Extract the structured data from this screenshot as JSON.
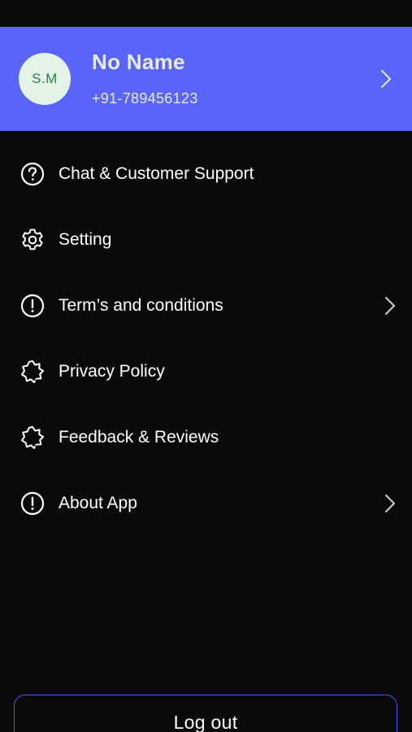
{
  "header": {
    "avatar_initials": "S.M",
    "name": "No Name",
    "phone": "+91-789456123",
    "chevron_icon": "chevron-right-icon"
  },
  "menu": {
    "items": [
      {
        "label": "Chat & Customer Support",
        "icon": "help-circle-icon",
        "has_chevron": false
      },
      {
        "label": "Setting",
        "icon": "gear-icon",
        "has_chevron": false
      },
      {
        "label": "Term’s and conditions",
        "icon": "info-circle-icon",
        "has_chevron": true
      },
      {
        "label": "Privacy Policy",
        "icon": "badge-star-icon",
        "has_chevron": false
      },
      {
        "label": "Feedback & Reviews",
        "icon": "badge-star-icon",
        "has_chevron": false
      },
      {
        "label": "About App",
        "icon": "info-circle-icon",
        "has_chevron": true
      }
    ]
  },
  "footer": {
    "logout_label": "Log out"
  },
  "colors": {
    "background": "#0a0a0a",
    "header": "#5865f8",
    "avatar_bg": "#e3f3e6",
    "avatar_text": "#2e7d4a",
    "logout_border": "#4a56e8"
  }
}
